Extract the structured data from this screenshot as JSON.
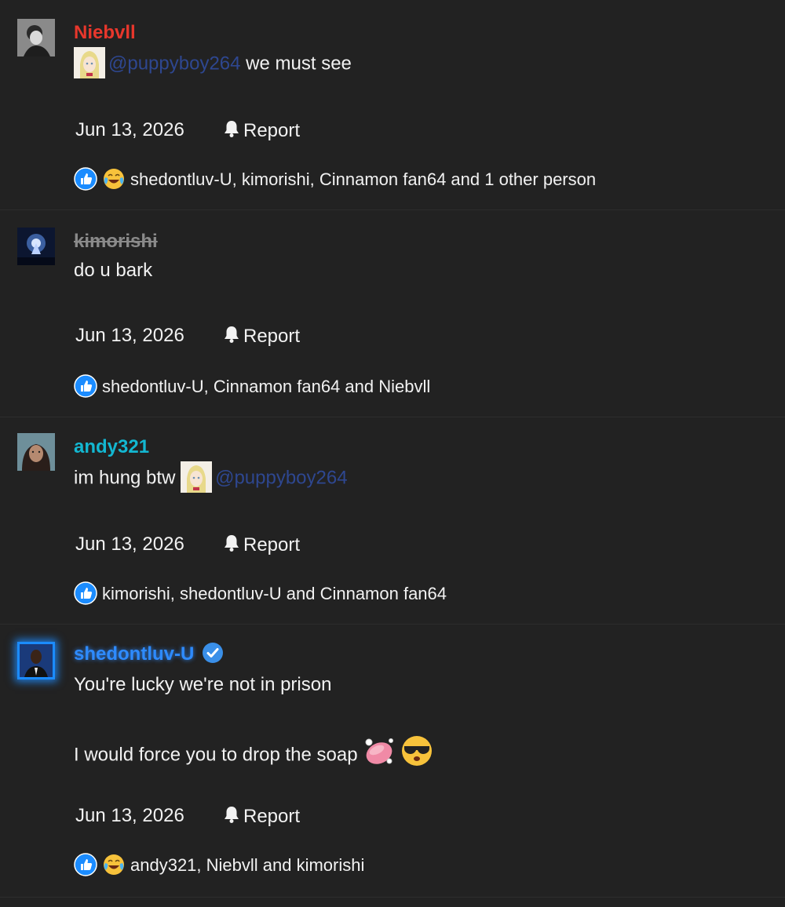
{
  "colors": {
    "background": "#222222",
    "text": "#f2f2f2",
    "mention": "#2e4790",
    "niebvll": "#e8372c",
    "kimorishi": "#8a8a8a",
    "andy321": "#13b7d1",
    "shedontluv": "#2e8bff",
    "like_blue": "#1b8cff"
  },
  "comments": [
    {
      "username": "Niebvll",
      "lines": [
        "@puppyboy264",
        "we must see"
      ],
      "date": "Jun 13, 2026",
      "report_label": "Report",
      "reactions_text": "shedontluv-U, kimorishi, Cinnamon fan64 and 1 other person",
      "reaction_icons": [
        "like-icon",
        "laughing-tears-emoji"
      ]
    },
    {
      "username": "kimorishi",
      "lines": [
        "do u bark"
      ],
      "date": "Jun 13, 2026",
      "report_label": "Report",
      "reactions_text": "shedontluv-U, Cinnamon fan64 and Niebvll",
      "reaction_icons": [
        "like-icon"
      ]
    },
    {
      "username": "andy321",
      "lines": [
        "im hung btw",
        "@puppyboy264"
      ],
      "date": "Jun 13, 2026",
      "report_label": "Report",
      "reactions_text": "kimorishi, shedontluv-U and Cinnamon fan64",
      "reaction_icons": [
        "like-icon"
      ]
    },
    {
      "username": "shedontluv-U",
      "lines": [
        "You're lucky we're not in prison",
        "I would force you to drop the soap"
      ],
      "date": "Jun 13, 2026",
      "report_label": "Report",
      "reactions_text": "andy321, Niebvll and kimorishi",
      "reaction_icons": [
        "like-icon",
        "laughing-tears-emoji"
      ]
    }
  ]
}
